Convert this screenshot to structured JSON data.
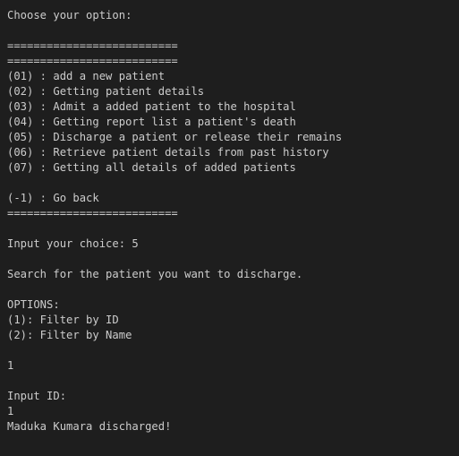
{
  "terminal": {
    "lines": [
      "Choose your option:",
      "",
      "==========================",
      "==========================",
      "(01) : add a new patient",
      "(02) : Getting patient details",
      "(03) : Admit a added patient to the hospital",
      "(04) : Getting report list a patient's death",
      "(05) : Discharge a patient or release their remains",
      "(06) : Retrieve patient details from past history",
      "(07) : Getting all details of added patients",
      "",
      "(-1) : Go back",
      "==========================",
      "",
      "Input your choice: 5",
      "",
      "Search for the patient you want to discharge.",
      "",
      "OPTIONS:",
      "(1): Filter by ID",
      "(2): Filter by Name",
      "",
      "1",
      "",
      "Input ID:",
      "1",
      "Maduka Kumara discharged!"
    ]
  },
  "colors": {
    "background": "#1e1e1e",
    "text": "#cccccc"
  }
}
